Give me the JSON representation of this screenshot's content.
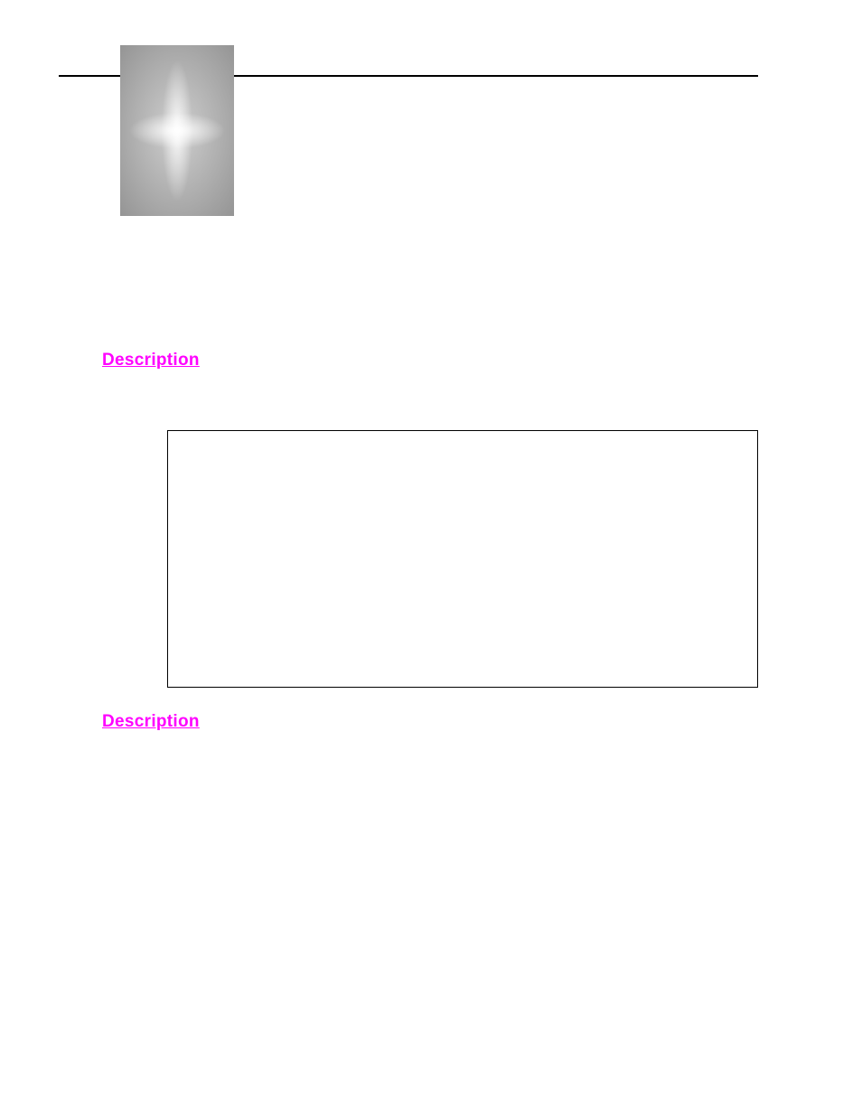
{
  "headings": {
    "first": "Description",
    "second": "Description"
  }
}
